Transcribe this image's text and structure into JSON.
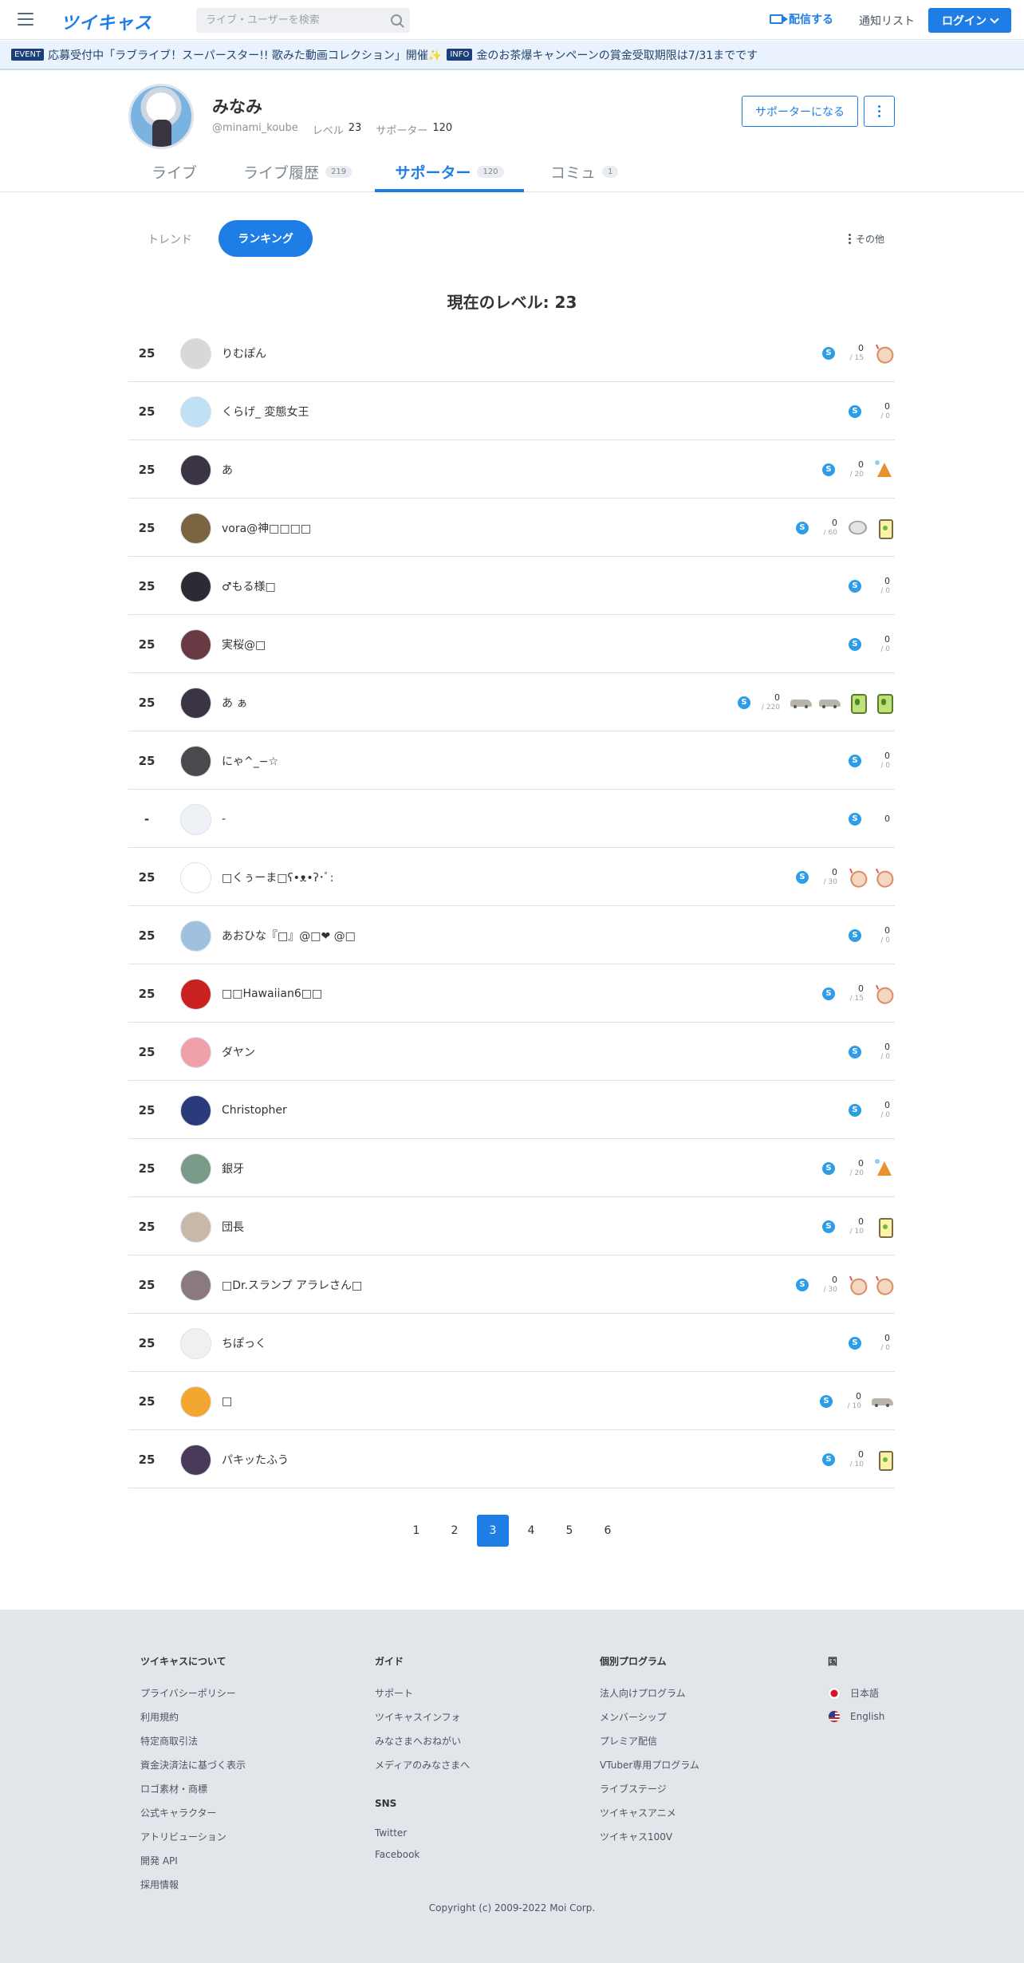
{
  "header": {
    "logo": "ツイキャス",
    "search_placeholder": "ライブ・ユーザーを検索",
    "broadcast_label": "配信する",
    "notify_label": "通知リスト",
    "login_label": "ログイン"
  },
  "ticker": [
    {
      "tag": "EVENT",
      "text": "応募受付中「ラブライブ！スーパースター!! 歌みた動画コレクション」開催✨"
    },
    {
      "tag": "INFO",
      "text": "金のお茶爆キャンペーンの賞金受取期限は7/31までです"
    }
  ],
  "profile": {
    "name": "みなみ",
    "handle": "@minami_koube",
    "level_label": "レベル",
    "level": "23",
    "supporters_label": "サポーター",
    "supporters": "120",
    "support_button": "サポーターになる"
  },
  "tabs": [
    {
      "label": "ライブ",
      "count": ""
    },
    {
      "label": "ライブ履歴",
      "count": "219"
    },
    {
      "label": "サポーター",
      "count": "120"
    },
    {
      "label": "コミュ",
      "count": "1"
    }
  ],
  "subtabs": {
    "trend": "トレンド",
    "ranking": "ランキング",
    "other": "その他"
  },
  "current_level": "現在のレベル: 23",
  "supporters": [
    {
      "rank": "25",
      "name": "りむぽん",
      "points": "0",
      "total": "/ 15",
      "items": [
        "clap"
      ],
      "avatar": "#d8d8d8"
    },
    {
      "rank": "25",
      "name": "くらげ_ 変態女王",
      "points": "0",
      "total": "/ 0",
      "items": [],
      "avatar": "#bfe0f5"
    },
    {
      "rank": "25",
      "name": "あ",
      "points": "0",
      "total": "/ 20",
      "items": [
        "cone"
      ],
      "avatar": "#3a3445"
    },
    {
      "rank": "25",
      "name": "vora@神□□□□",
      "points": "0",
      "total": "/ 60",
      "items": [
        "coin",
        "drink"
      ],
      "avatar": "#7a6540"
    },
    {
      "rank": "25",
      "name": "♂もる様□",
      "points": "0",
      "total": "/ 0",
      "items": [],
      "avatar": "#2e2a33"
    },
    {
      "rank": "25",
      "name": "実桜@□",
      "points": "0",
      "total": "/ 0",
      "items": [],
      "avatar": "#6a3a44"
    },
    {
      "rank": "25",
      "name": "あ ぁ",
      "points": "0",
      "total": "/ 220",
      "items": [
        "car",
        "car",
        "gdrink",
        "gdrink"
      ],
      "avatar": "#3a3445"
    },
    {
      "rank": "25",
      "name": "にゃ^_−☆",
      "points": "0",
      "total": "/ 0",
      "items": [],
      "avatar": "#4a4a4e"
    },
    {
      "rank": "-",
      "name": "-",
      "points": "0",
      "total": "",
      "items": [],
      "avatar": "#eef1f5"
    },
    {
      "rank": "25",
      "name": "□くぅーま□ʕ•ᴥ•ʔ･ﾟ:",
      "points": "0",
      "total": "/ 30",
      "items": [
        "clap",
        "clap"
      ],
      "avatar": "#ffffff"
    },
    {
      "rank": "25",
      "name": "あおひな『□』@□❤ @□",
      "points": "0",
      "total": "/ 0",
      "items": [],
      "avatar": "#9fc0de"
    },
    {
      "rank": "25",
      "name": "□□Hawaiian6□□",
      "points": "0",
      "total": "/ 15",
      "items": [
        "clap"
      ],
      "avatar": "#c92020"
    },
    {
      "rank": "25",
      "name": "ダヤン",
      "points": "0",
      "total": "/ 0",
      "items": [],
      "avatar": "#f0a0a8"
    },
    {
      "rank": "25",
      "name": "Christopher",
      "points": "0",
      "total": "/ 0",
      "items": [],
      "avatar": "#2a3a7a"
    },
    {
      "rank": "25",
      "name": "銀牙",
      "points": "0",
      "total": "/ 20",
      "items": [
        "cone"
      ],
      "avatar": "#7a9a8a"
    },
    {
      "rank": "25",
      "name": "団長",
      "points": "0",
      "total": "/ 10",
      "items": [
        "drink"
      ],
      "avatar": "#c8b8a8"
    },
    {
      "rank": "25",
      "name": "□Dr.スランプ アラレさん□",
      "points": "0",
      "total": "/ 30",
      "items": [
        "clap",
        "clap"
      ],
      "avatar": "#8a7a80"
    },
    {
      "rank": "25",
      "name": "ちぽっく",
      "points": "0",
      "total": "/ 0",
      "items": [],
      "avatar": "#f0f0f0"
    },
    {
      "rank": "25",
      "name": "□",
      "points": "0",
      "total": "/ 10",
      "items": [
        "car"
      ],
      "avatar": "#f2a530"
    },
    {
      "rank": "25",
      "name": "パキッたふう",
      "points": "0",
      "total": "/ 10",
      "items": [
        "drink"
      ],
      "avatar": "#4a3a5a"
    }
  ],
  "pagination": {
    "pages": [
      "1",
      "2",
      "3",
      "4",
      "5",
      "6"
    ],
    "active": "3"
  },
  "footer": {
    "about": {
      "heading": "ツイキャスについて",
      "links": [
        "プライバシーポリシー",
        "利用規約",
        "特定商取引法",
        "資金決済法に基づく表示",
        "ロゴ素材・商標",
        "公式キャラクター",
        "アトリビューション",
        "開発 API",
        "採用情報"
      ]
    },
    "guide": {
      "heading": "ガイド",
      "links": [
        "サポート",
        "ツイキャスインフォ",
        "みなさまへおねがい",
        "メディアのみなさまへ"
      ]
    },
    "sns": {
      "heading": "SNS",
      "links": [
        "Twitter",
        "Facebook"
      ]
    },
    "programs": {
      "heading": "個別プログラム",
      "links": [
        "法人向けプログラム",
        "メンバーシップ",
        "プレミア配信",
        "VTuber専用プログラム",
        "ライブステージ",
        "ツイキャスアニメ",
        "ツイキャス100V"
      ]
    },
    "country": {
      "heading": "国",
      "langs": [
        "日本語",
        "English"
      ]
    },
    "copyright": "Copyright (c) 2009-2022 Moi Corp."
  }
}
